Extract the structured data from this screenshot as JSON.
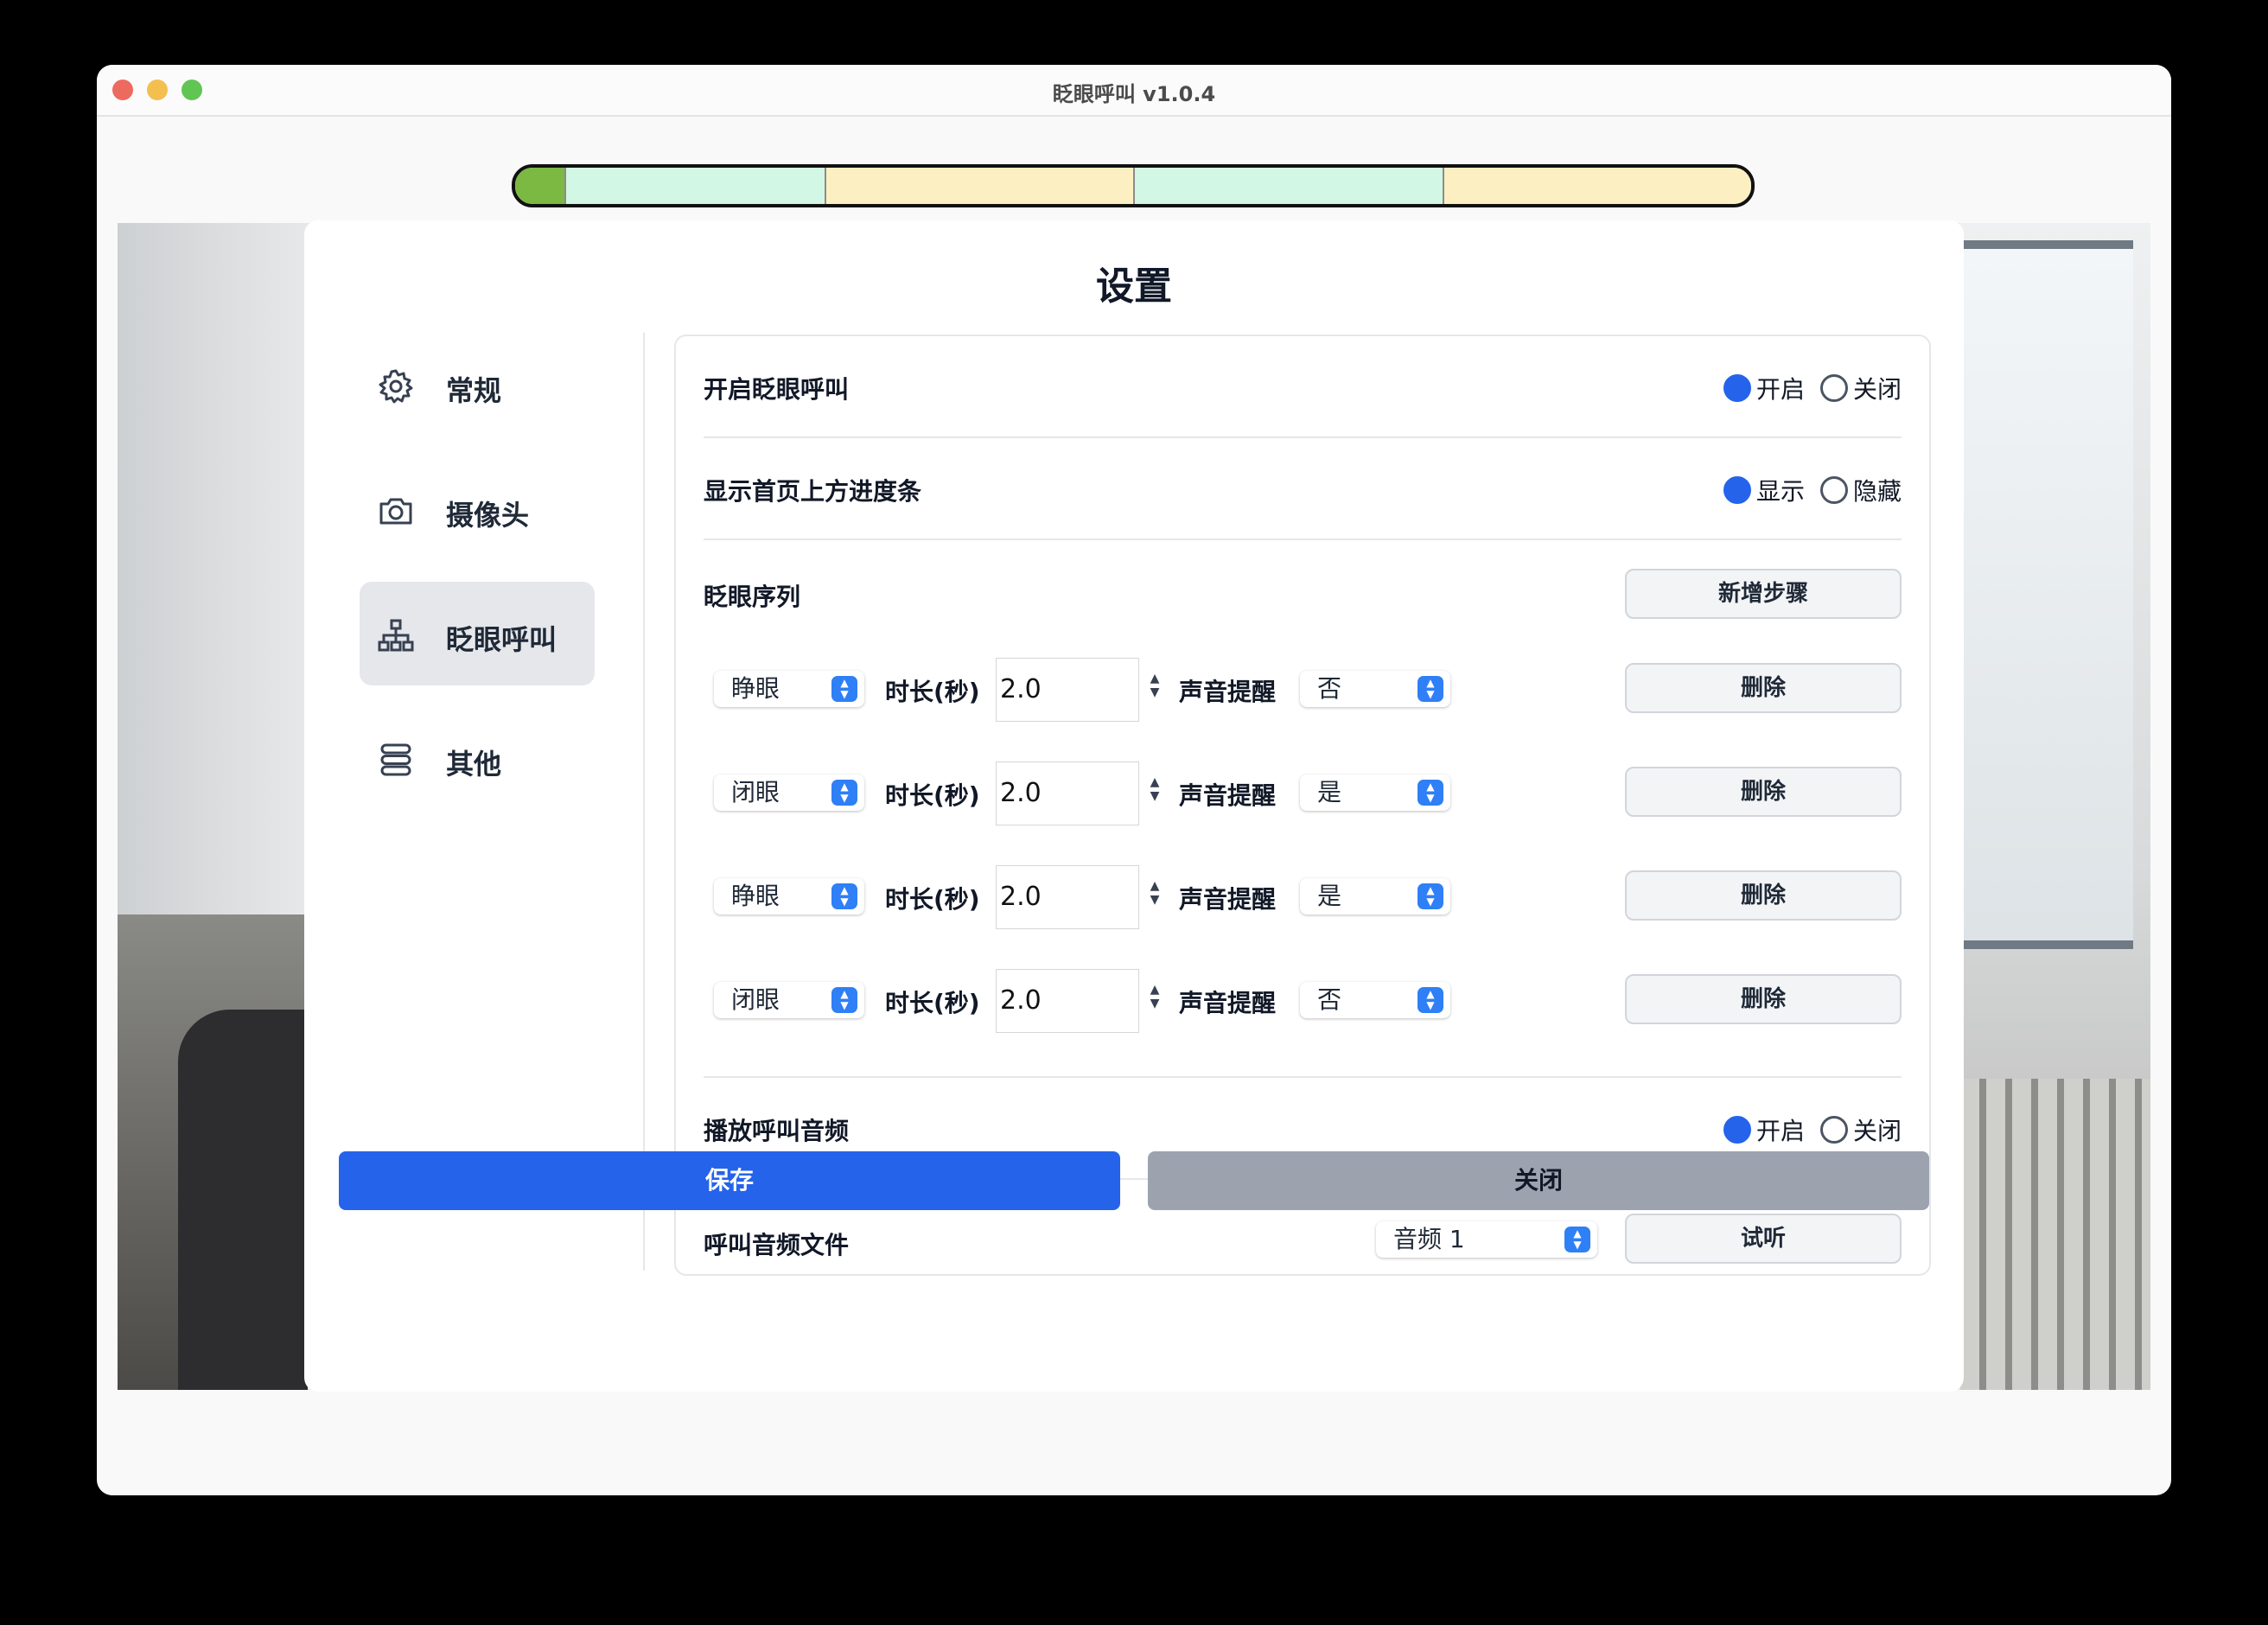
{
  "window": {
    "title": "眨眼呼叫 v1.0.4"
  },
  "top_progress": {
    "segments": [
      {
        "color": "#7cb943",
        "fraction": 0.04
      },
      {
        "color": "#d2f7e4",
        "fraction": 0.21
      },
      {
        "color": "#fcf0c3",
        "fraction": 0.25
      },
      {
        "color": "#d2f7e4",
        "fraction": 0.25
      },
      {
        "color": "#fcf0c3",
        "fraction": 0.25
      }
    ]
  },
  "dialog": {
    "title": "设置"
  },
  "sidebar": {
    "items": [
      {
        "label": "常规",
        "icon": "gear-icon",
        "active": false
      },
      {
        "label": "摄像头",
        "icon": "camera-icon",
        "active": false
      },
      {
        "label": "眨眼呼叫",
        "icon": "sitemap-icon",
        "active": true
      },
      {
        "label": "其他",
        "icon": "stack-icon",
        "active": false
      }
    ]
  },
  "settings": {
    "enable_blink_call": {
      "label": "开启眨眼呼叫",
      "options": [
        "开启",
        "关闭"
      ],
      "selected": "开启"
    },
    "show_progress_bar": {
      "label": "显示首页上方进度条",
      "options": [
        "显示",
        "隐藏"
      ],
      "selected": "显示"
    },
    "blink_sequence": {
      "label": "眨眼序列",
      "add_step_label": "新增步骤",
      "duration_label": "时长(秒)",
      "sound_label": "声音提醒",
      "delete_label": "删除",
      "steps": [
        {
          "eye_state": "睁眼",
          "duration": "2.0",
          "sound": "否"
        },
        {
          "eye_state": "闭眼",
          "duration": "2.0",
          "sound": "是"
        },
        {
          "eye_state": "睁眼",
          "duration": "2.0",
          "sound": "是"
        },
        {
          "eye_state": "闭眼",
          "duration": "2.0",
          "sound": "否"
        }
      ]
    },
    "play_call_audio": {
      "label": "播放呼叫音频",
      "options": [
        "开启",
        "关闭"
      ],
      "selected": "开启"
    },
    "call_audio_file": {
      "label": "呼叫音频文件",
      "selected_file": "音频 1",
      "preview_label": "试听"
    }
  },
  "footer": {
    "save_label": "保存",
    "close_label": "关闭"
  },
  "colors": {
    "primary": "#2563eb",
    "secondary_button": "#9ca3af"
  }
}
